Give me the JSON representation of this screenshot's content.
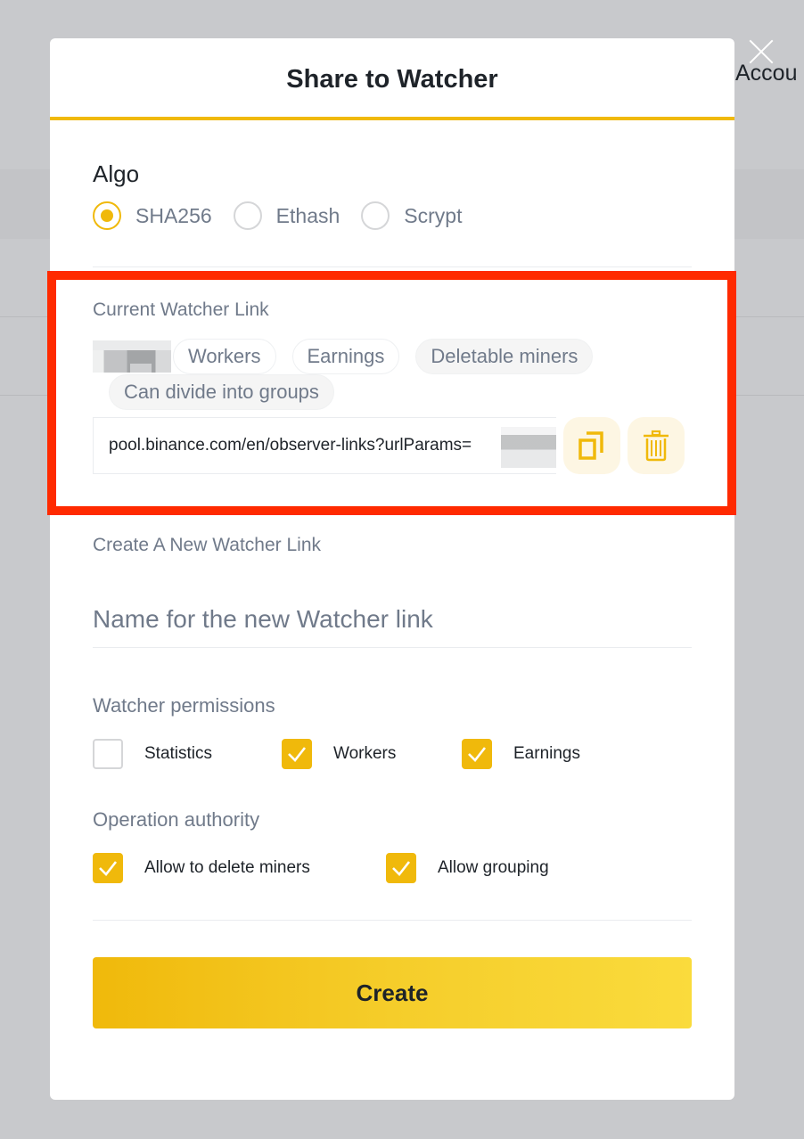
{
  "background": {
    "account_text": "Accou"
  },
  "modal": {
    "title": "Share to Watcher",
    "algo": {
      "label": "Algo",
      "options": [
        {
          "label": "SHA256",
          "selected": true
        },
        {
          "label": "Ethash",
          "selected": false
        },
        {
          "label": "Scrypt",
          "selected": false
        }
      ]
    },
    "current_link": {
      "label": "Current Watcher Link",
      "tags": [
        "Workers",
        "Earnings",
        "Deletable miners",
        "Can divide into groups"
      ],
      "url": "pool.binance.com/en/observer-links?urlParams=",
      "copy_icon": "copy-icon",
      "delete_icon": "trash-icon"
    },
    "create_new": {
      "label": "Create A New Watcher Link",
      "name_placeholder": "Name for the new Watcher link",
      "name_value": ""
    },
    "permissions": {
      "label": "Watcher permissions",
      "items": [
        {
          "label": "Statistics",
          "checked": false
        },
        {
          "label": "Workers",
          "checked": true
        },
        {
          "label": "Earnings",
          "checked": true
        }
      ]
    },
    "operation": {
      "label": "Operation authority",
      "items": [
        {
          "label": "Allow to delete miners",
          "checked": true
        },
        {
          "label": "Allow grouping",
          "checked": true
        }
      ]
    },
    "create_button": "Create"
  },
  "colors": {
    "accent": "#f0b90b",
    "highlight": "#ff2a00",
    "text_primary": "#1e2329",
    "text_secondary": "#707a8a"
  }
}
